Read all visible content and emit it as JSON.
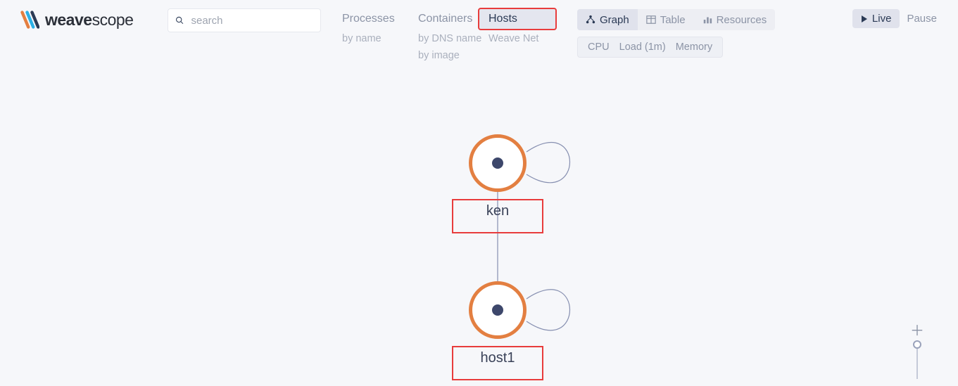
{
  "brand": {
    "bold": "weave",
    "light": "scope"
  },
  "search": {
    "placeholder": "search"
  },
  "topology": {
    "processes": {
      "label": "Processes",
      "subs": [
        "by name"
      ]
    },
    "containers": {
      "label": "Containers",
      "subs": [
        "by DNS name",
        "by image"
      ]
    },
    "hosts": {
      "label": "Hosts",
      "subs": [
        "Weave Net"
      ]
    }
  },
  "views": {
    "graph": "Graph",
    "table": "Table",
    "resources": "Resources"
  },
  "metrics": [
    "CPU",
    "Load (1m)",
    "Memory"
  ],
  "time": {
    "live": "Live",
    "pause": "Pause"
  },
  "nodes": {
    "n1": "ken",
    "n2": "host1"
  }
}
